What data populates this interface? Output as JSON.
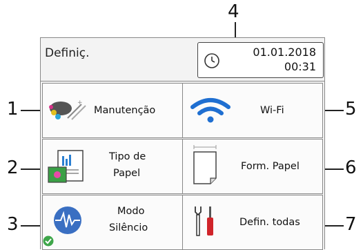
{
  "callouts": {
    "c1": "1",
    "c2": "2",
    "c3": "3",
    "c4": "4",
    "c5": "5",
    "c6": "6",
    "c7": "7"
  },
  "header": {
    "title": "Definiç.",
    "date": "01.01.2018",
    "time": "00:31"
  },
  "tiles": {
    "maintenance": {
      "label": "Manutenção"
    },
    "wifi": {
      "label": "Wi-Fi"
    },
    "paper_type": {
      "line1": "Tipo de",
      "line2": "Papel"
    },
    "paper_size": {
      "label": "Form. Papel"
    },
    "quiet_mode": {
      "line1": "Modo",
      "line2": "Silêncio"
    },
    "all_settings": {
      "label": "Defin. todas"
    }
  },
  "colors": {
    "wifi_blue": "#1f6fd1",
    "quiet_blue": "#3a6fc2",
    "check_green": "#3ea64a",
    "tool_red": "#d0242a"
  }
}
